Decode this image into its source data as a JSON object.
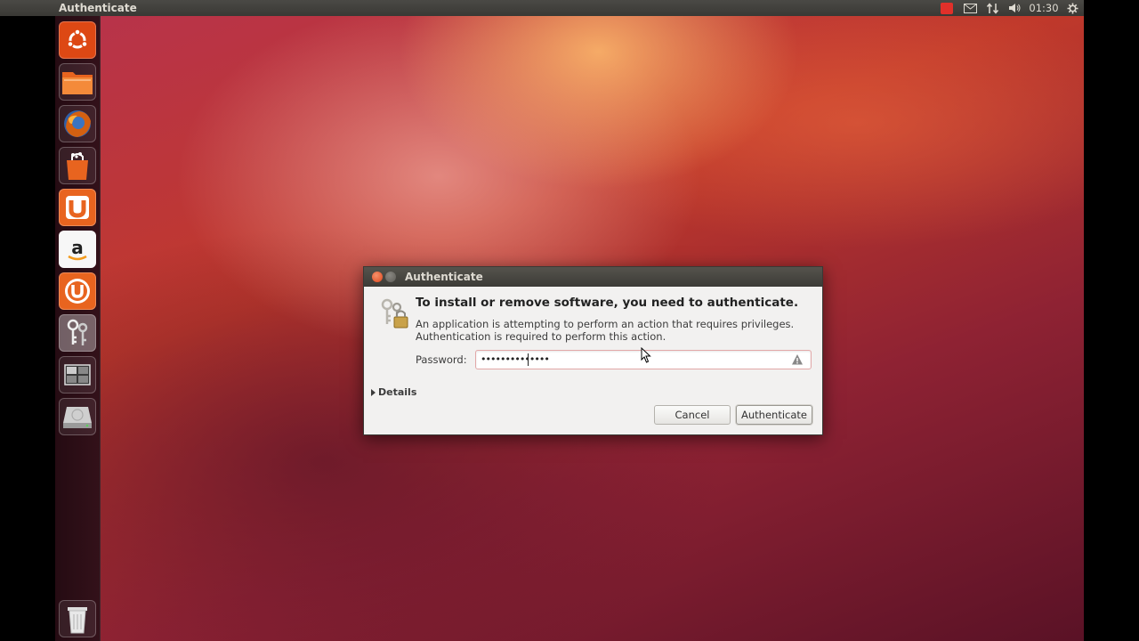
{
  "top_panel": {
    "title": "Authenticate",
    "clock": "01:30",
    "indicators": [
      "record-icon",
      "mail-icon",
      "network-icon",
      "volume-icon",
      "gear-icon"
    ]
  },
  "launcher": {
    "items": [
      {
        "name": "dash-home",
        "icon": "ubuntu-logo-icon"
      },
      {
        "name": "files",
        "icon": "folder-icon"
      },
      {
        "name": "firefox",
        "icon": "firefox-icon"
      },
      {
        "name": "software-center",
        "icon": "shopping-bag-icon"
      },
      {
        "name": "ubuntu-one",
        "icon": "ubuntu-one-icon"
      },
      {
        "name": "amazon",
        "icon": "amazon-icon"
      },
      {
        "name": "ubuntu-one-music",
        "icon": "ubuntu-one-music-icon"
      },
      {
        "name": "system-settings",
        "icon": "keys-icon"
      },
      {
        "name": "workspace-switcher",
        "icon": "workspaces-icon"
      },
      {
        "name": "disk-drive",
        "icon": "hard-drive-icon"
      }
    ],
    "trash_icon": "trash-icon"
  },
  "dialog": {
    "title": "Authenticate",
    "heading": "To install or remove software, you need to authenticate.",
    "description_line1": "An application is attempting to perform an action that requires privileges.",
    "description_line2": "Authentication is required to perform this action.",
    "password_label": "Password:",
    "password_value": "••••••••••••••",
    "details_label": "Details",
    "cancel_label": "Cancel",
    "authenticate_label": "Authenticate"
  }
}
